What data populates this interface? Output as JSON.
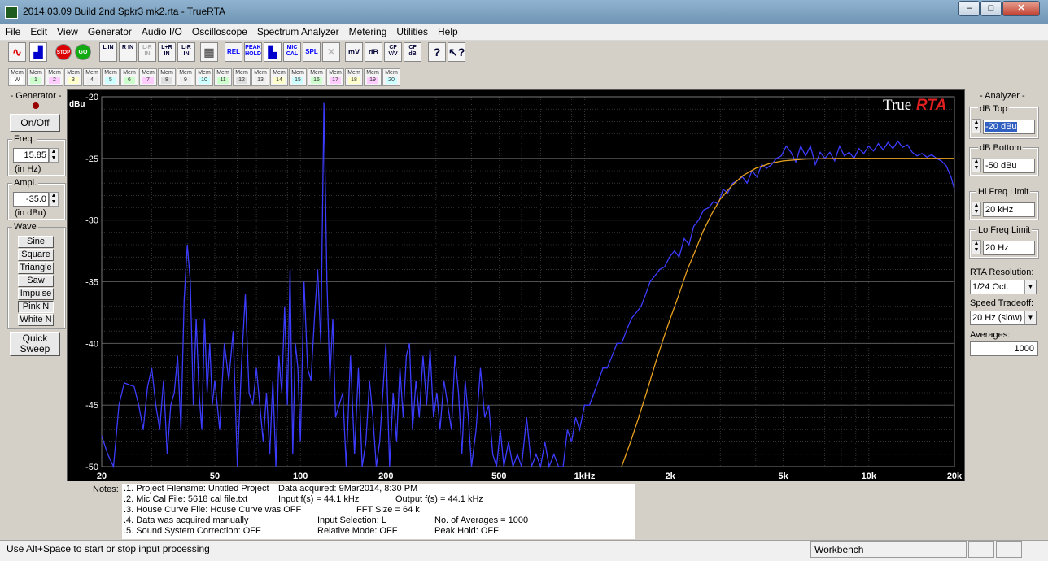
{
  "titlebar": {
    "title": "2014.03.09 Build 2nd Spkr3 mk2.rta - TrueRTA"
  },
  "menu": [
    "File",
    "Edit",
    "View",
    "Generator",
    "Audio I/O",
    "Oscilloscope",
    "Spectrum Analyzer",
    "Metering",
    "Utilities",
    "Help"
  ],
  "toolbar": {
    "left_in": "L IN",
    "right_in": "R IN",
    "lr_in_dim": "L-R IN",
    "l_plus_r": "L+R IN",
    "l_minus_r": "L-R IN",
    "rel": "REL",
    "peak_hold": "PEAK HOLD",
    "mic_cal": "MIC CAL",
    "spl": "SPL",
    "mv": "mV",
    "db": "dB",
    "cf_vv": "CF V/V",
    "cf_db": "CF dB",
    "stop": "STOP",
    "go": "GO"
  },
  "mem_buttons": [
    "W",
    "1",
    "2",
    "3",
    "4",
    "5",
    "6",
    "7",
    "8",
    "9",
    "10",
    "11",
    "12",
    "13",
    "14",
    "15",
    "16",
    "17",
    "18",
    "19",
    "20"
  ],
  "mem_label": "Mem",
  "generator": {
    "title": "- Generator -",
    "onoff": "On/Off",
    "freq_label": "Freq.",
    "freq_value": "15.85",
    "freq_unit": "(in Hz)",
    "ampl_label": "Ampl.",
    "ampl_value": "-35.0",
    "ampl_unit": "(in dBu)",
    "wave_label": "Wave",
    "waves": [
      "Sine",
      "Square",
      "Triangle",
      "Saw",
      "Impulse",
      "Pink N",
      "White N"
    ],
    "quick_sweep": "Quick Sweep"
  },
  "analyzer": {
    "title": "- Analyzer -",
    "db_top_label": "dB Top",
    "db_top_value": "-20 dBu",
    "db_bottom_label": "dB Bottom",
    "db_bottom_value": "-50 dBu",
    "hi_freq_label": "Hi Freq Limit",
    "hi_freq_value": "20 kHz",
    "lo_freq_label": "Lo Freq Limit",
    "lo_freq_value": "20 Hz",
    "rta_res_label": "RTA Resolution:",
    "rta_res_value": "1/24 Oct.",
    "speed_label": "Speed Tradeoff:",
    "speed_value": "20 Hz (slow)",
    "averages_label": "Averages:",
    "averages_value": "1000"
  },
  "chart_brand": {
    "part1": "True",
    "part2": "RTA"
  },
  "colors": {
    "measured": "#3c3cff",
    "target": "#e8a020",
    "grid": "#555555",
    "bg": "#000000",
    "brand_red": "#e02020"
  },
  "notes": {
    "label": "Notes:",
    "lines": [
      ".1. Project Filename: Untitled Project",
      ".2. Mic Cal File: 5618 cal file.txt",
      ".3. House Curve File: House Curve was OFF",
      ".4. Data was acquired manually",
      ".5. Sound System Correction: OFF"
    ],
    "data_acquired": "Data acquired: 9Mar2014, 8:30 PM",
    "input_fs": "Input f(s) = 44.1 kHz",
    "output_fs": "Output f(s) = 44.1 kHz",
    "fft_size": "FFT Size = 64 k",
    "input_sel": "Input Selection: L",
    "num_avg": "No. of Averages = 1000",
    "rel_mode": "Relative Mode:  OFF",
    "peak_hold": "Peak Hold: OFF"
  },
  "status": {
    "hint": "Use Alt+Space to start or stop input processing",
    "mode": "Workbench"
  },
  "chart_data": {
    "type": "line",
    "xscale": "log",
    "ylabel": "dBu",
    "xlim": [
      20,
      20000
    ],
    "ylim": [
      -50,
      -20
    ],
    "yticks": [
      -20,
      -25,
      -30,
      -35,
      -40,
      -45,
      -50
    ],
    "xtick_labels": [
      "20",
      "50",
      "100",
      "200",
      "500",
      "1kHz",
      "2k",
      "5k",
      "10k",
      "20k"
    ],
    "xticks": [
      20,
      50,
      100,
      200,
      500,
      1000,
      2000,
      5000,
      10000,
      20000
    ],
    "grid": true,
    "series": [
      {
        "color": "#3c3cff",
        "points": [
          [
            20,
            -47.5
          ],
          [
            21,
            -49
          ],
          [
            22,
            -50
          ],
          [
            23,
            -45
          ],
          [
            24,
            -43.2
          ],
          [
            26,
            -43.5
          ],
          [
            27,
            -45
          ],
          [
            28,
            -47
          ],
          [
            29,
            -43.5
          ],
          [
            30,
            -42
          ],
          [
            31,
            -45
          ],
          [
            32,
            -47
          ],
          [
            33,
            -43
          ],
          [
            34,
            -49
          ],
          [
            35,
            -45
          ],
          [
            36,
            -44
          ],
          [
            37,
            -41
          ],
          [
            38,
            -47
          ],
          [
            39,
            -36.5
          ],
          [
            40,
            -32
          ],
          [
            41,
            -35
          ],
          [
            42,
            -45
          ],
          [
            43,
            -38
          ],
          [
            44,
            -44
          ],
          [
            45,
            -47
          ],
          [
            46,
            -38
          ],
          [
            47,
            -44
          ],
          [
            48,
            -40
          ],
          [
            49,
            -45
          ],
          [
            50,
            -43
          ],
          [
            52,
            -47
          ],
          [
            54,
            -40
          ],
          [
            56,
            -43
          ],
          [
            58,
            -39
          ],
          [
            60,
            -50
          ],
          [
            62,
            -42
          ],
          [
            64,
            -36
          ],
          [
            66,
            -44
          ],
          [
            68,
            -45
          ],
          [
            70,
            -42
          ],
          [
            72,
            -45
          ],
          [
            74,
            -48
          ],
          [
            76,
            -44
          ],
          [
            78,
            -49
          ],
          [
            80,
            -43
          ],
          [
            82,
            -50
          ],
          [
            84,
            -41
          ],
          [
            86,
            -44
          ],
          [
            88,
            -37
          ],
          [
            90,
            -45
          ],
          [
            92,
            -34
          ],
          [
            94,
            -49
          ],
          [
            96,
            -40
          ],
          [
            98,
            -42
          ],
          [
            100,
            -48
          ],
          [
            103,
            -35
          ],
          [
            106,
            -42
          ],
          [
            109,
            -43
          ],
          [
            112,
            -38
          ],
          [
            115,
            -34
          ],
          [
            118,
            -40
          ],
          [
            121,
            -20.5
          ],
          [
            124,
            -35
          ],
          [
            127,
            -43
          ],
          [
            130,
            -38
          ],
          [
            133,
            -46
          ],
          [
            137,
            -45
          ],
          [
            141,
            -44
          ],
          [
            145,
            -50
          ],
          [
            150,
            -41
          ],
          [
            155,
            -49
          ],
          [
            160,
            -42
          ],
          [
            165,
            -50
          ],
          [
            170,
            -48
          ],
          [
            175,
            -43
          ],
          [
            180,
            -46
          ],
          [
            185,
            -50
          ],
          [
            190,
            -48
          ],
          [
            195,
            -44
          ],
          [
            200,
            -40
          ],
          [
            206,
            -50
          ],
          [
            212,
            -44
          ],
          [
            218,
            -48
          ],
          [
            224,
            -42
          ],
          [
            230,
            -46
          ],
          [
            236,
            -41
          ],
          [
            242,
            -40
          ],
          [
            248,
            -47
          ],
          [
            255,
            -43
          ],
          [
            262,
            -46
          ],
          [
            270,
            -41
          ],
          [
            278,
            -45
          ],
          [
            286,
            -40.5
          ],
          [
            294,
            -46
          ],
          [
            302,
            -44
          ],
          [
            310,
            -47
          ],
          [
            320,
            -43
          ],
          [
            330,
            -45
          ],
          [
            340,
            -47
          ],
          [
            350,
            -41
          ],
          [
            360,
            -44
          ],
          [
            370,
            -49
          ],
          [
            380,
            -43
          ],
          [
            390,
            -46
          ],
          [
            400,
            -50
          ],
          [
            415,
            -47
          ],
          [
            430,
            -42
          ],
          [
            445,
            -46
          ],
          [
            460,
            -45
          ],
          [
            475,
            -49
          ],
          [
            490,
            -50
          ],
          [
            505,
            -47
          ],
          [
            520,
            -50
          ],
          [
            540,
            -48
          ],
          [
            560,
            -50
          ],
          [
            580,
            -49
          ],
          [
            600,
            -50
          ],
          [
            625,
            -46
          ],
          [
            650,
            -50
          ],
          [
            675,
            -49
          ],
          [
            700,
            -50
          ],
          [
            725,
            -48
          ],
          [
            750,
            -50
          ],
          [
            780,
            -49
          ],
          [
            810,
            -50
          ],
          [
            840,
            -50
          ],
          [
            870,
            -47
          ],
          [
            900,
            -48
          ],
          [
            930,
            -46
          ],
          [
            960,
            -47
          ],
          [
            1000,
            -45
          ],
          [
            1040,
            -45
          ],
          [
            1080,
            -44
          ],
          [
            1120,
            -43
          ],
          [
            1160,
            -42
          ],
          [
            1200,
            -42
          ],
          [
            1250,
            -41
          ],
          [
            1300,
            -40
          ],
          [
            1350,
            -40
          ],
          [
            1400,
            -39
          ],
          [
            1460,
            -38
          ],
          [
            1520,
            -37.5
          ],
          [
            1580,
            -37
          ],
          [
            1640,
            -36
          ],
          [
            1700,
            -35
          ],
          [
            1770,
            -34.5
          ],
          [
            1840,
            -34
          ],
          [
            1910,
            -33.8
          ],
          [
            1990,
            -33
          ],
          [
            2070,
            -32.5
          ],
          [
            2150,
            -33
          ],
          [
            2240,
            -31.5
          ],
          [
            2330,
            -32
          ],
          [
            2420,
            -30.5
          ],
          [
            2520,
            -30
          ],
          [
            2620,
            -29.2
          ],
          [
            2730,
            -29
          ],
          [
            2840,
            -28.5
          ],
          [
            2950,
            -28.7
          ],
          [
            3070,
            -27.5
          ],
          [
            3190,
            -27.8
          ],
          [
            3320,
            -27
          ],
          [
            3450,
            -26.8
          ],
          [
            3590,
            -26.5
          ],
          [
            3730,
            -27
          ],
          [
            3880,
            -26
          ],
          [
            4040,
            -26.5
          ],
          [
            4200,
            -25.5
          ],
          [
            4370,
            -25.8
          ],
          [
            4550,
            -25.5
          ],
          [
            4730,
            -25
          ],
          [
            4920,
            -24.8
          ],
          [
            5120,
            -24
          ],
          [
            5320,
            -24.5
          ],
          [
            5540,
            -25.3
          ],
          [
            5760,
            -24
          ],
          [
            5990,
            -24.8
          ],
          [
            6230,
            -24
          ],
          [
            6480,
            -25.5
          ],
          [
            6740,
            -24.5
          ],
          [
            7010,
            -25
          ],
          [
            7290,
            -24.5
          ],
          [
            7580,
            -25.2
          ],
          [
            7890,
            -24
          ],
          [
            8200,
            -24.8
          ],
          [
            8530,
            -24.5
          ],
          [
            8870,
            -25
          ],
          [
            9230,
            -24.2
          ],
          [
            9600,
            -24.6
          ],
          [
            9980,
            -24
          ],
          [
            10380,
            -24.4
          ],
          [
            10800,
            -23.8
          ],
          [
            11230,
            -24.3
          ],
          [
            11680,
            -23.7
          ],
          [
            12150,
            -24.2
          ],
          [
            12630,
            -23.6
          ],
          [
            13140,
            -24.1
          ],
          [
            13670,
            -23.9
          ],
          [
            14210,
            -24.5
          ],
          [
            14780,
            -24.8
          ],
          [
            15370,
            -24.6
          ],
          [
            15990,
            -24.9
          ],
          [
            16630,
            -24.7
          ],
          [
            17300,
            -25
          ],
          [
            17990,
            -25.2
          ],
          [
            18710,
            -25.6
          ],
          [
            19460,
            -26.5
          ],
          [
            20000,
            -27.5
          ]
        ]
      },
      {
        "color": "#e8a020",
        "points": [
          [
            1350,
            -50
          ],
          [
            1450,
            -48
          ],
          [
            1550,
            -46
          ],
          [
            1650,
            -44
          ],
          [
            1780,
            -41.5
          ],
          [
            1900,
            -39.5
          ],
          [
            2000,
            -38
          ],
          [
            2150,
            -36
          ],
          [
            2300,
            -34
          ],
          [
            2450,
            -32.5
          ],
          [
            2600,
            -31
          ],
          [
            2800,
            -29.5
          ],
          [
            3000,
            -28.3
          ],
          [
            3300,
            -27.2
          ],
          [
            3600,
            -26.4
          ],
          [
            4000,
            -25.8
          ],
          [
            4500,
            -25.4
          ],
          [
            5000,
            -25.2
          ],
          [
            6000,
            -25.05
          ],
          [
            8000,
            -25
          ],
          [
            20000,
            -25
          ]
        ]
      }
    ]
  }
}
